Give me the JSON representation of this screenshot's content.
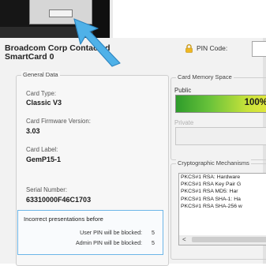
{
  "reader": {
    "title": "Broadcom Corp Contacted SmartCard 0"
  },
  "mini_window": {
    "button_label": ""
  },
  "pin": {
    "label": "PIN Code:",
    "value": ""
  },
  "general": {
    "title": "General Data",
    "card_type_label": "Card Type:",
    "card_type": "Classic V3",
    "firmware_label": "Card Firmware Version:",
    "firmware": "3.03",
    "card_label_label": "Card Label:",
    "card_label": "GemP15-1",
    "serial_label": "Serial Number:",
    "serial": "63310000F46C1703"
  },
  "presentations": {
    "title": "Incorrect presentations before",
    "user_label": "User PIN will be blocked:",
    "user_value": "5",
    "admin_label": "Admin PIN will be blocked:",
    "admin_value": "5"
  },
  "memory": {
    "title": "Card Memory Space",
    "public_label": "Public",
    "public_percent": "100%",
    "public_fill": 1.0,
    "private_label": "Private"
  },
  "crypto": {
    "title": "Cryptographic Mechanisms",
    "items": [
      "PKCS#1 RSA: Hardware",
      "PKCS#1 RSA Key Pair G",
      "PKCS#1 RSA MD5: Har",
      "PKCS#1 RSA SHA-1: Ha",
      "PKCS#1 RSA SHA-256 w"
    ],
    "scroll_left_glyph": "<"
  },
  "colors": {
    "accent_blue": "#5aa9e6",
    "progress_green": "#2e9c2b",
    "progress_yellow": "#e6e83f",
    "frame_dark": "#161616"
  },
  "icons": {
    "cursor": "arrow-cursor-icon",
    "pin": "lock-icon"
  }
}
